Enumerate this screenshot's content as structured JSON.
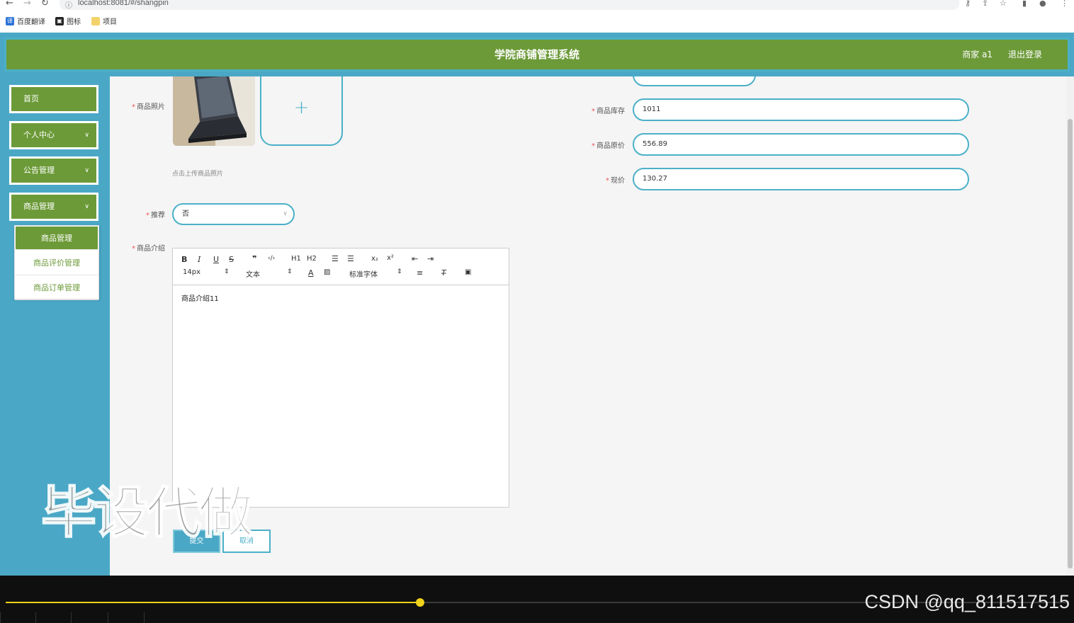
{
  "browser": {
    "url": "localhost:8081/#/shangpin",
    "bookmarks": [
      "百度翻译",
      "图标",
      "项目"
    ]
  },
  "header": {
    "title": "学院商铺管理系统",
    "user": "商家 a1",
    "logout": "退出登录"
  },
  "sidebar": {
    "items": [
      {
        "label": "首页",
        "has_chevron": false
      },
      {
        "label": "个人中心",
        "has_chevron": true
      },
      {
        "label": "公告管理",
        "has_chevron": true
      },
      {
        "label": "商品管理",
        "has_chevron": true
      }
    ],
    "submenu": [
      "商品管理",
      "商品评价管理",
      "商品订单管理"
    ]
  },
  "form": {
    "photo_label": "商品照片",
    "upload_tip": "点击上传商品照片",
    "upload_plus": "+",
    "recommend_label": "推荐",
    "recommend_value": "否",
    "intro_label": "商品介绍",
    "intro_content": "商品介绍11",
    "stock_label": "商品库存",
    "stock_value": "1011",
    "original_price_label": "商品原价",
    "original_price_value": "556.89",
    "current_price_label": "现价",
    "current_price_value": "130.27",
    "submit": "提交",
    "cancel": "取消"
  },
  "editor_toolbar": {
    "font_size": "14px",
    "paragraph": "文本",
    "font_family": "标准字体",
    "h1": "H1",
    "h2": "H2"
  },
  "overlay": {
    "watermark": "毕设代做",
    "credit": "CSDN @qq_811517515"
  },
  "video": {
    "progress": 0.39
  },
  "colors": {
    "primary_green": "#6c9a38",
    "accent_blue": "#4aa8c6",
    "progress_yellow": "#f1d31b"
  }
}
